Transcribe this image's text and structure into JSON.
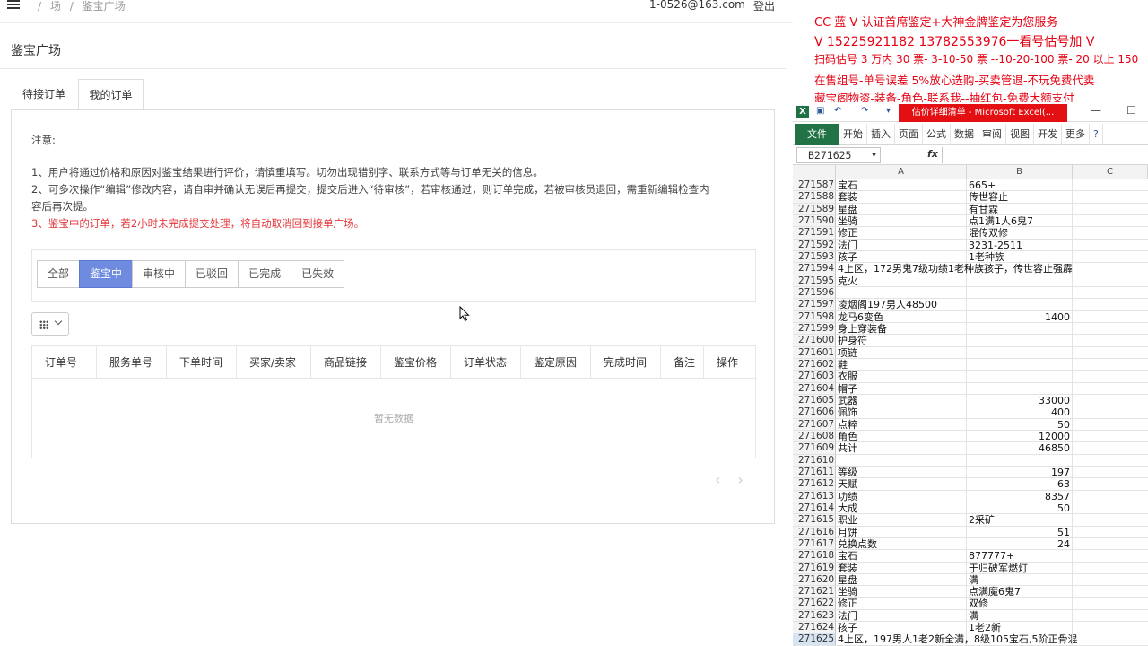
{
  "web": {
    "breadcrumb": [
      "/",
      "场",
      "/",
      "鉴宝广场"
    ],
    "account": "1-0526@163.com",
    "logout": "登出",
    "page_title": "鉴宝广场",
    "tabs": [
      "待接订单",
      "我的订单"
    ],
    "notice": {
      "heading": "注意:",
      "line1": "1、用户将通过价格和原因对鉴宝结果进行评价，请慎重填写。切勿出现错别字、联系方式等与订单无关的信息。",
      "line2a": "2、可多次操作“编辑”修改内容，请自审并确认无误后再提交，提交后进入“待审核”，若审核通过，则订单完成，若被审核员退回，需重新编辑检查内",
      "line2b": "容后再次提。",
      "line3": "3、鉴宝中的订单，若2小时未完成提交处理，将自动取消回到接单广场。"
    },
    "filters": [
      "全部",
      "鉴宝中",
      "审核中",
      "已驳回",
      "已完成",
      "已失效"
    ],
    "active_filter": "鉴宝中",
    "columns": [
      "订单号",
      "服务单号",
      "下单时间",
      "买家/卖家",
      "商品链接",
      "鉴宝价格",
      "订单状态",
      "鉴定原因",
      "完成时间",
      "备注",
      "操作"
    ],
    "empty_text": "暂无数据",
    "pager_prev": "‹",
    "pager_next": "›",
    "active_color": "#6e8be0",
    "warning_color": "#e4393c"
  },
  "overlay": {
    "line1": "CC 蓝 V 认证首席鉴定+大神金牌鉴定为您服务",
    "line2": "V 15225921182    13782553976一看号估号加 V",
    "line3": "扫码估号 3 万内 30 票- 3-10-50 票  --10-20-100 票- 20 以上 150",
    "line4": "在售组号-单号误差 5%放心选购-买卖管退-不玩免费代卖",
    "line5": "藏宝阁物资-装备-角色-联系我--抽红包-免费大额支付",
    "color": "#e60012"
  },
  "excel": {
    "window_title": "估价详细清单 - Microsoft Excel(...",
    "ribbon_file": "文件",
    "ribbon_tabs": [
      "开始",
      "插入",
      "页面",
      "公式",
      "数据",
      "审阅",
      "视图",
      "开发",
      "更多"
    ],
    "name_box": "B271625",
    "fx": "fx",
    "col_headers": [
      "A",
      "B",
      "C"
    ],
    "rows": [
      {
        "n": "271587",
        "a": "宝石",
        "b": "665+"
      },
      {
        "n": "271588",
        "a": "套装",
        "b": "传世容止"
      },
      {
        "n": "271589",
        "a": "星盘",
        "b": "有甘霖"
      },
      {
        "n": "271590",
        "a": "坐骑",
        "b": "点1满1人6鬼7"
      },
      {
        "n": "271591",
        "a": "修正",
        "b": "混传双修"
      },
      {
        "n": "271592",
        "a": "法门",
        "b": "3231-2511"
      },
      {
        "n": "271593",
        "a": "孩子",
        "b": "1老种族"
      },
      {
        "n": "271594",
        "a": "4上区，172男鬼7级功绩1老种族孩子，传世容止强霹",
        "b": ""
      },
      {
        "n": "271595",
        "a": "克火",
        "b": ""
      },
      {
        "n": "271596",
        "a": "",
        "b": ""
      },
      {
        "n": "271597",
        "a": "凌烟阁197男人48500",
        "b": ""
      },
      {
        "n": "271598",
        "a": "龙马6变色",
        "b": "1400"
      },
      {
        "n": "271599",
        "a": "身上穿装备",
        "b": ""
      },
      {
        "n": "271600",
        "a": "护身符",
        "b": ""
      },
      {
        "n": "271601",
        "a": "项链",
        "b": ""
      },
      {
        "n": "271602",
        "a": "鞋",
        "b": ""
      },
      {
        "n": "271603",
        "a": "衣服",
        "b": ""
      },
      {
        "n": "271604",
        "a": "帽子",
        "b": ""
      },
      {
        "n": "271605",
        "a": "武器",
        "b": "33000"
      },
      {
        "n": "271606",
        "a": "佩饰",
        "b": "400"
      },
      {
        "n": "271607",
        "a": "点粹",
        "b": "50"
      },
      {
        "n": "271608",
        "a": "角色",
        "b": "12000"
      },
      {
        "n": "271609",
        "a": "共计",
        "b": "46850"
      },
      {
        "n": "271610",
        "a": "",
        "b": ""
      },
      {
        "n": "271611",
        "a": "等级",
        "b": "197"
      },
      {
        "n": "271612",
        "a": "天赋",
        "b": "63"
      },
      {
        "n": "271613",
        "a": "功绩",
        "b": "8357"
      },
      {
        "n": "271614",
        "a": "大成",
        "b": "50"
      },
      {
        "n": "271615",
        "a": "职业",
        "b": "2采矿"
      },
      {
        "n": "271616",
        "a": "月饼",
        "b": "51"
      },
      {
        "n": "271617",
        "a": "兑换点数",
        "b": "24"
      },
      {
        "n": "271618",
        "a": "宝石",
        "b": "877777+"
      },
      {
        "n": "271619",
        "a": "套装",
        "b": "于归破军燃灯"
      },
      {
        "n": "271620",
        "a": "星盘",
        "b": "满"
      },
      {
        "n": "271621",
        "a": "坐骑",
        "b": "点满魔6鬼7"
      },
      {
        "n": "271622",
        "a": "修正",
        "b": "双修"
      },
      {
        "n": "271623",
        "a": "法门",
        "b": "满"
      },
      {
        "n": "271624",
        "a": "孩子",
        "b": "1老2新"
      },
      {
        "n": "271625",
        "a": "4上区，197男人1老2新全满，8级105宝石,5阶正骨混",
        "b": ""
      }
    ],
    "accent": "#217346",
    "title_color": "#e40f12"
  }
}
